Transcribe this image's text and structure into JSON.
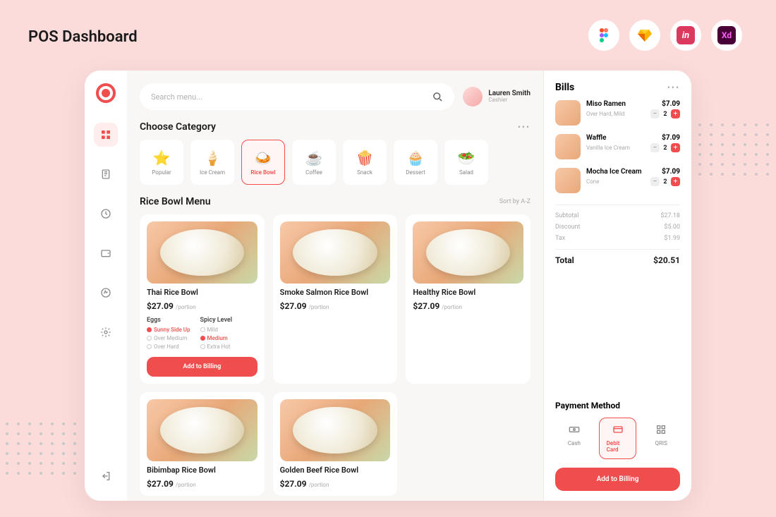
{
  "page_title": "POS Dashboard",
  "tool_badges": [
    "figma",
    "sketch",
    "invision",
    "xd"
  ],
  "search": {
    "placeholder": "Search menu..."
  },
  "user": {
    "name": "Lauren Smith",
    "role": "Cashier"
  },
  "categories": {
    "heading": "Choose Category",
    "items": [
      {
        "icon": "⭐",
        "label": "Popular"
      },
      {
        "icon": "🍦",
        "label": "Ice Cream"
      },
      {
        "icon": "🍛",
        "label": "Rice Bowl",
        "active": true
      },
      {
        "icon": "☕",
        "label": "Coffee"
      },
      {
        "icon": "🍿",
        "label": "Snack"
      },
      {
        "icon": "🧁",
        "label": "Dessert"
      },
      {
        "icon": "🥗",
        "label": "Salad"
      }
    ]
  },
  "menu": {
    "heading": "Rice Bowl Menu",
    "sort_label": "Sort by A-Z",
    "unit": "/portion",
    "items": [
      {
        "name": "Thai Rice Bowl",
        "price": "$27.09",
        "expanded": true,
        "option_groups": [
          {
            "title": "Eggs",
            "options": [
              {
                "label": "Sunny Side Up",
                "selected": true
              },
              {
                "label": "Over Medium",
                "selected": false
              },
              {
                "label": "Over Hard",
                "selected": false
              }
            ]
          },
          {
            "title": "Spicy Level",
            "options": [
              {
                "label": "Mild",
                "selected": false
              },
              {
                "label": "Medium",
                "selected": true
              },
              {
                "label": "Extra Hot",
                "selected": false
              }
            ]
          }
        ],
        "button": "Add to Billing"
      },
      {
        "name": "Smoke Salmon Rice Bowl",
        "price": "$27.09"
      },
      {
        "name": "Healthy Rice Bowl",
        "price": "$27.09"
      },
      {
        "name": "Bibimbap Rice Bowl",
        "price": "$27.09"
      },
      {
        "name": "Golden Beef Rice Bowl",
        "price": "$27.09"
      }
    ]
  },
  "bills": {
    "heading": "Bills",
    "items": [
      {
        "name": "Miso Ramen",
        "note": "Over Hard, Mild",
        "price": "$7.09",
        "qty": "2"
      },
      {
        "name": "Waffle",
        "note": "Vanilla Ice Cream",
        "price": "$7.09",
        "qty": "2"
      },
      {
        "name": "Mocha Ice Cream",
        "note": "Cone",
        "price": "$7.09",
        "qty": "2"
      }
    ],
    "totals": {
      "subtotal_label": "Subtotal",
      "subtotal": "$27.18",
      "discount_label": "Discount",
      "discount": "$5.00",
      "tax_label": "Tax",
      "tax": "$1.99",
      "total_label": "Total",
      "total": "$20.51"
    }
  },
  "payment": {
    "heading": "Payment Method",
    "methods": [
      {
        "label": "Cash",
        "icon": "cash"
      },
      {
        "label": "Debit Card",
        "icon": "card",
        "active": true
      },
      {
        "label": "QRIS",
        "icon": "qr"
      }
    ],
    "button": "Add to Billing"
  }
}
